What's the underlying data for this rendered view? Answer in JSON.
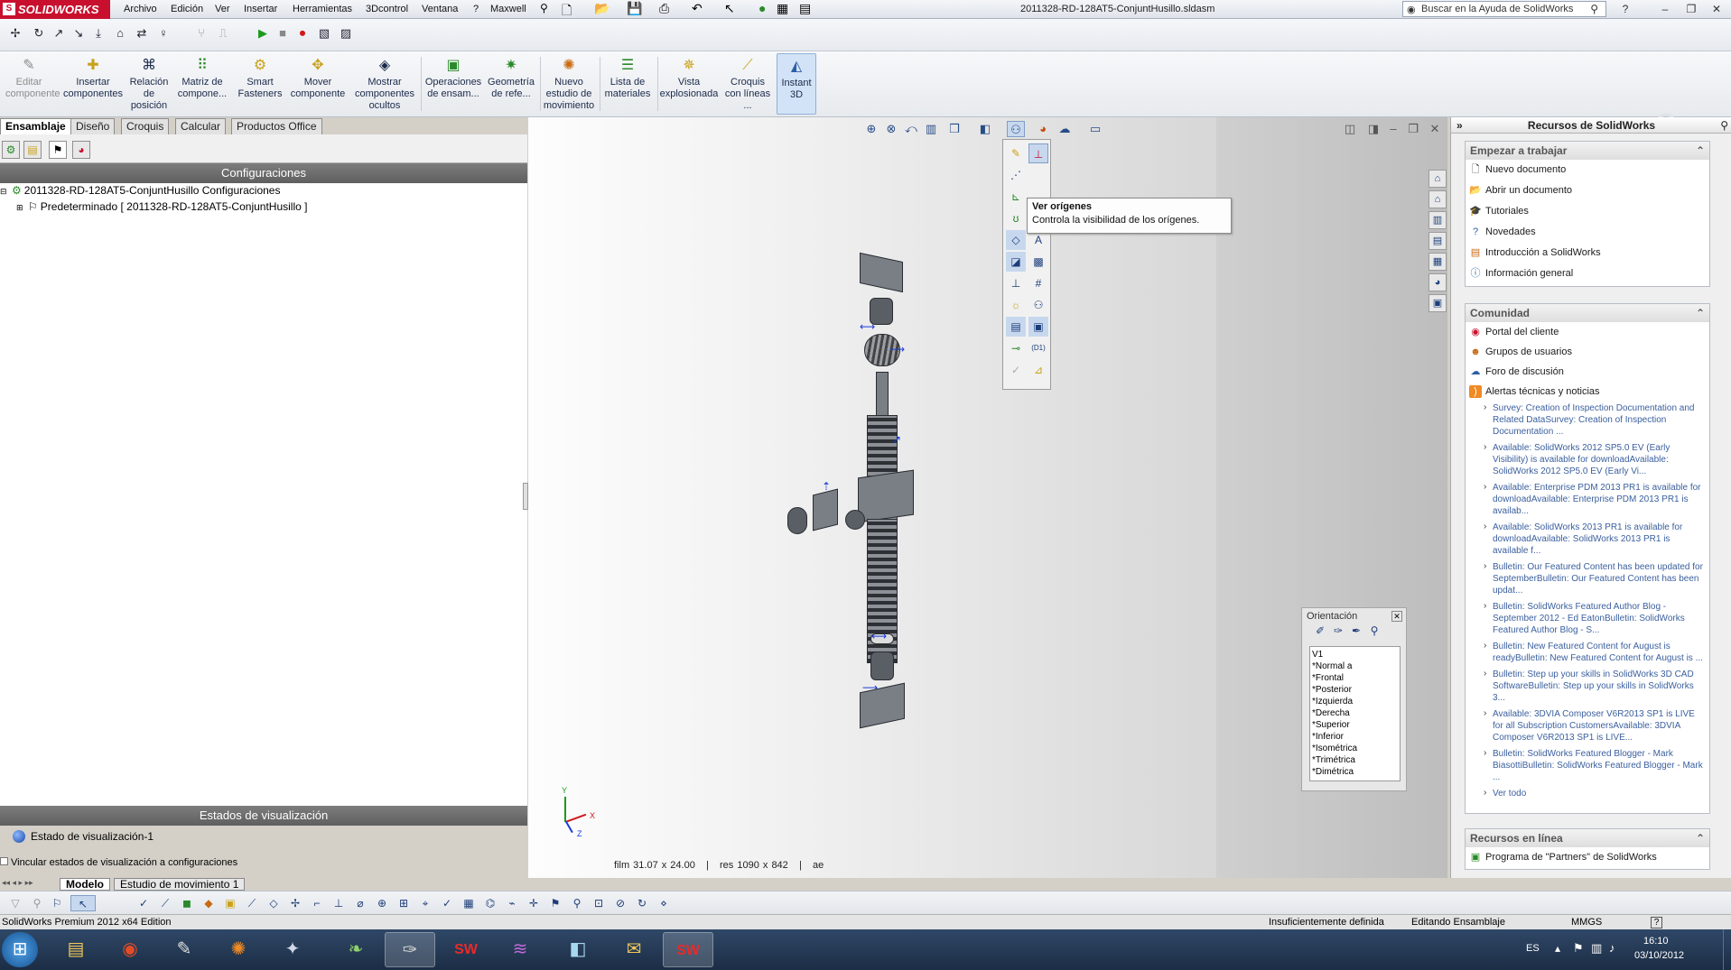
{
  "app": {
    "brand": "SOLIDWORKS",
    "window_title": "2011328-RD-128AT5-ConjuntHusillo.sldasm"
  },
  "menu": [
    "Archivo",
    "Edición",
    "Ver",
    "Insertar",
    "Herramientas",
    "3Dcontrol",
    "Ventana",
    "?",
    "Maxwell"
  ],
  "help_search": {
    "placeholder": "Buscar en la Ayuda de SolidWorks"
  },
  "ribbon": [
    {
      "label": "Editar componente",
      "icon": "edit-component-icon"
    },
    {
      "label": "Insertar componentes",
      "icon": "insert-components-icon"
    },
    {
      "label": "Relación de posición",
      "icon": "mate-icon"
    },
    {
      "label": "Matriz de compone...",
      "icon": "pattern-icon"
    },
    {
      "label": "Smart Fasteners",
      "icon": "fastener-icon"
    },
    {
      "label": "Mover componente",
      "icon": "move-component-icon"
    },
    {
      "label": "Mostrar componentes ocultos",
      "icon": "show-hidden-icon"
    },
    {
      "label": "Operaciones de ensam...",
      "icon": "assembly-features-icon"
    },
    {
      "label": "Geometría de refe...",
      "icon": "reference-geometry-icon"
    },
    {
      "label": "Nuevo estudio de movimiento",
      "icon": "motion-study-icon"
    },
    {
      "label": "Lista de materiales",
      "icon": "bom-icon"
    },
    {
      "label": "Vista explosionada",
      "icon": "exploded-view-icon"
    },
    {
      "label": "Croquis con líneas ...",
      "icon": "explode-line-icon"
    },
    {
      "label": "Instant 3D",
      "icon": "instant3d-icon"
    }
  ],
  "tabs": [
    "Ensamblaje",
    "Diseño",
    "Croquis",
    "Calcular",
    "Productos Office"
  ],
  "left": {
    "config_header": "Configuraciones",
    "root": "2011328-RD-128AT5-ConjuntHusillo Configuraciones",
    "child": "Predeterminado [ 2011328-RD-128AT5-ConjuntHusillo ]",
    "display_header": "Estados de visualización",
    "display_state": "Estado de visualización-1",
    "link_label": "Vincular estados de visualización a configuraciones"
  },
  "tooltip": {
    "title": "Ver orígenes",
    "text": "Controla la visibilidad de los orígenes."
  },
  "orientation": {
    "title": "Orientación",
    "items": [
      "V1",
      "*Normal a",
      "*Frontal",
      "*Posterior",
      "*Izquierda",
      "*Derecha",
      "*Superior",
      "*Inferior",
      "*Isométrica",
      "*Trimétrica",
      "*Dimétrica"
    ]
  },
  "viewport_status": "film 31.07 x 24.00   |   res 1090 x 842   |   ae",
  "triad": {
    "x": "X",
    "y": "Y",
    "z": "Z"
  },
  "taskpane": {
    "title": "Recursos de SolidWorks",
    "start": {
      "title": "Empezar a trabajar",
      "items": [
        "Nuevo documento",
        "Abrir un documento",
        "Tutoriales",
        "Novedades",
        "Introducción a SolidWorks",
        "Información general"
      ]
    },
    "community": {
      "title": "Comunidad",
      "items": [
        "Portal del cliente",
        "Grupos de usuarios",
        "Foro de discusión",
        "Alertas técnicas y noticias"
      ]
    },
    "news": [
      "Survey: Creation of Inspection Documentation and Related DataSurvey: Creation of Inspection Documentation ...",
      "Available: SolidWorks 2012 SP5.0 EV (Early Visibility) is available for downloadAvailable: SolidWorks 2012 SP5.0 EV (Early Vi...",
      "Available: Enterprise PDM 2013 PR1 is available for downloadAvailable: Enterprise PDM 2013 PR1 is availab...",
      "Available: SolidWorks 2013 PR1 is available for downloadAvailable: SolidWorks 2013 PR1 is available f...",
      "Bulletin: Our Featured Content has been updated for SeptemberBulletin: Our Featured Content has been updat...",
      "Bulletin: SolidWorks Featured Author Blog - September 2012 - Ed EatonBulletin: SolidWorks Featured Author Blog - S...",
      "Bulletin: New Featured Content for August is readyBulletin: New Featured Content for August is ...",
      "Bulletin: Step up your skills in SolidWorks 3D CAD SoftwareBulletin: Step up your skills in SolidWorks 3...",
      "Available: 3DVIA Composer V6R2013 SP1 is LIVE for all Subscription CustomersAvailable: 3DVIA Composer V6R2013 SP1 is LIVE...",
      "Bulletin: SolidWorks Featured Blogger - Mark BiasottiBulletin: SolidWorks Featured Blogger - Mark ..."
    ],
    "view_all": "Ver todo",
    "online": {
      "title": "Recursos en línea",
      "items": [
        "Programa de \"Partners\" de SolidWorks"
      ]
    }
  },
  "bottom_tabs": [
    "Modelo",
    "Estudio de movimiento 1"
  ],
  "status": {
    "edition": "SolidWorks Premium 2012 x64 Edition",
    "state": "Insuficientemente definida",
    "mode": "Editando Ensamblaje",
    "units": "MMGS"
  },
  "tray": {
    "lang": "ES",
    "time": "16:10",
    "date": "03/10/2012"
  },
  "colors": {
    "accent": "#c8102e",
    "panel_header": "#6a6a6a",
    "link": "#3a5f9e",
    "taskbar": "#23364f"
  }
}
